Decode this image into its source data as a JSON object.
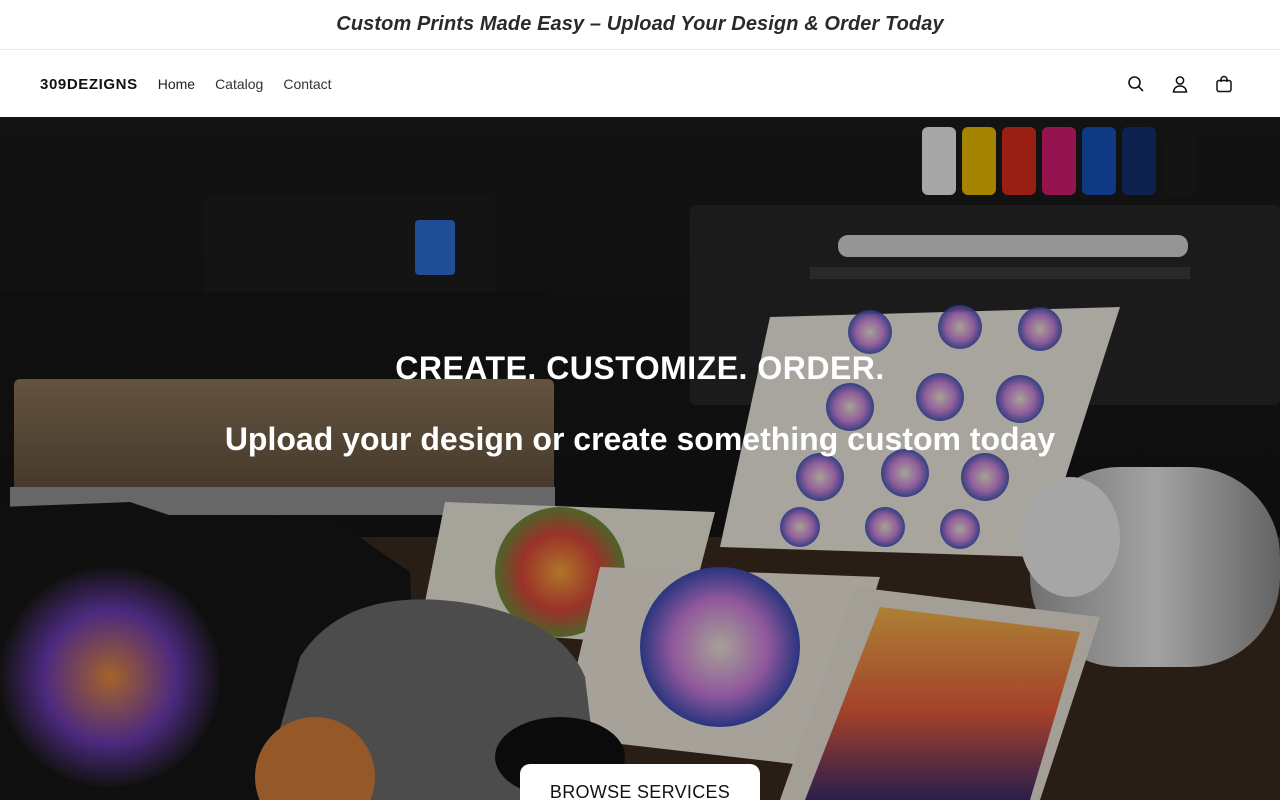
{
  "announcement": {
    "text": "Custom Prints Made Easy – Upload Your Design & Order Today"
  },
  "header": {
    "logo": "309DEZIGNS",
    "nav": [
      {
        "label": "Home"
      },
      {
        "label": "Catalog"
      },
      {
        "label": "Contact"
      }
    ],
    "icons": [
      "search-icon",
      "account-icon",
      "cart-icon"
    ]
  },
  "hero": {
    "title": "CREATE. CUSTOMIZE. ORDER.",
    "subtitle": "Upload your design or create something custom today",
    "button_label": "BROWSE SERVICES"
  },
  "colors": {
    "background": "#ffffff",
    "text": "#121212",
    "hero_text": "#ffffff",
    "ink_bottles": [
      "#eaeaea",
      "#e6b800",
      "#d72b1e",
      "#d01c6f",
      "#1550b5",
      "#14306e",
      "#1a1a1a"
    ]
  }
}
